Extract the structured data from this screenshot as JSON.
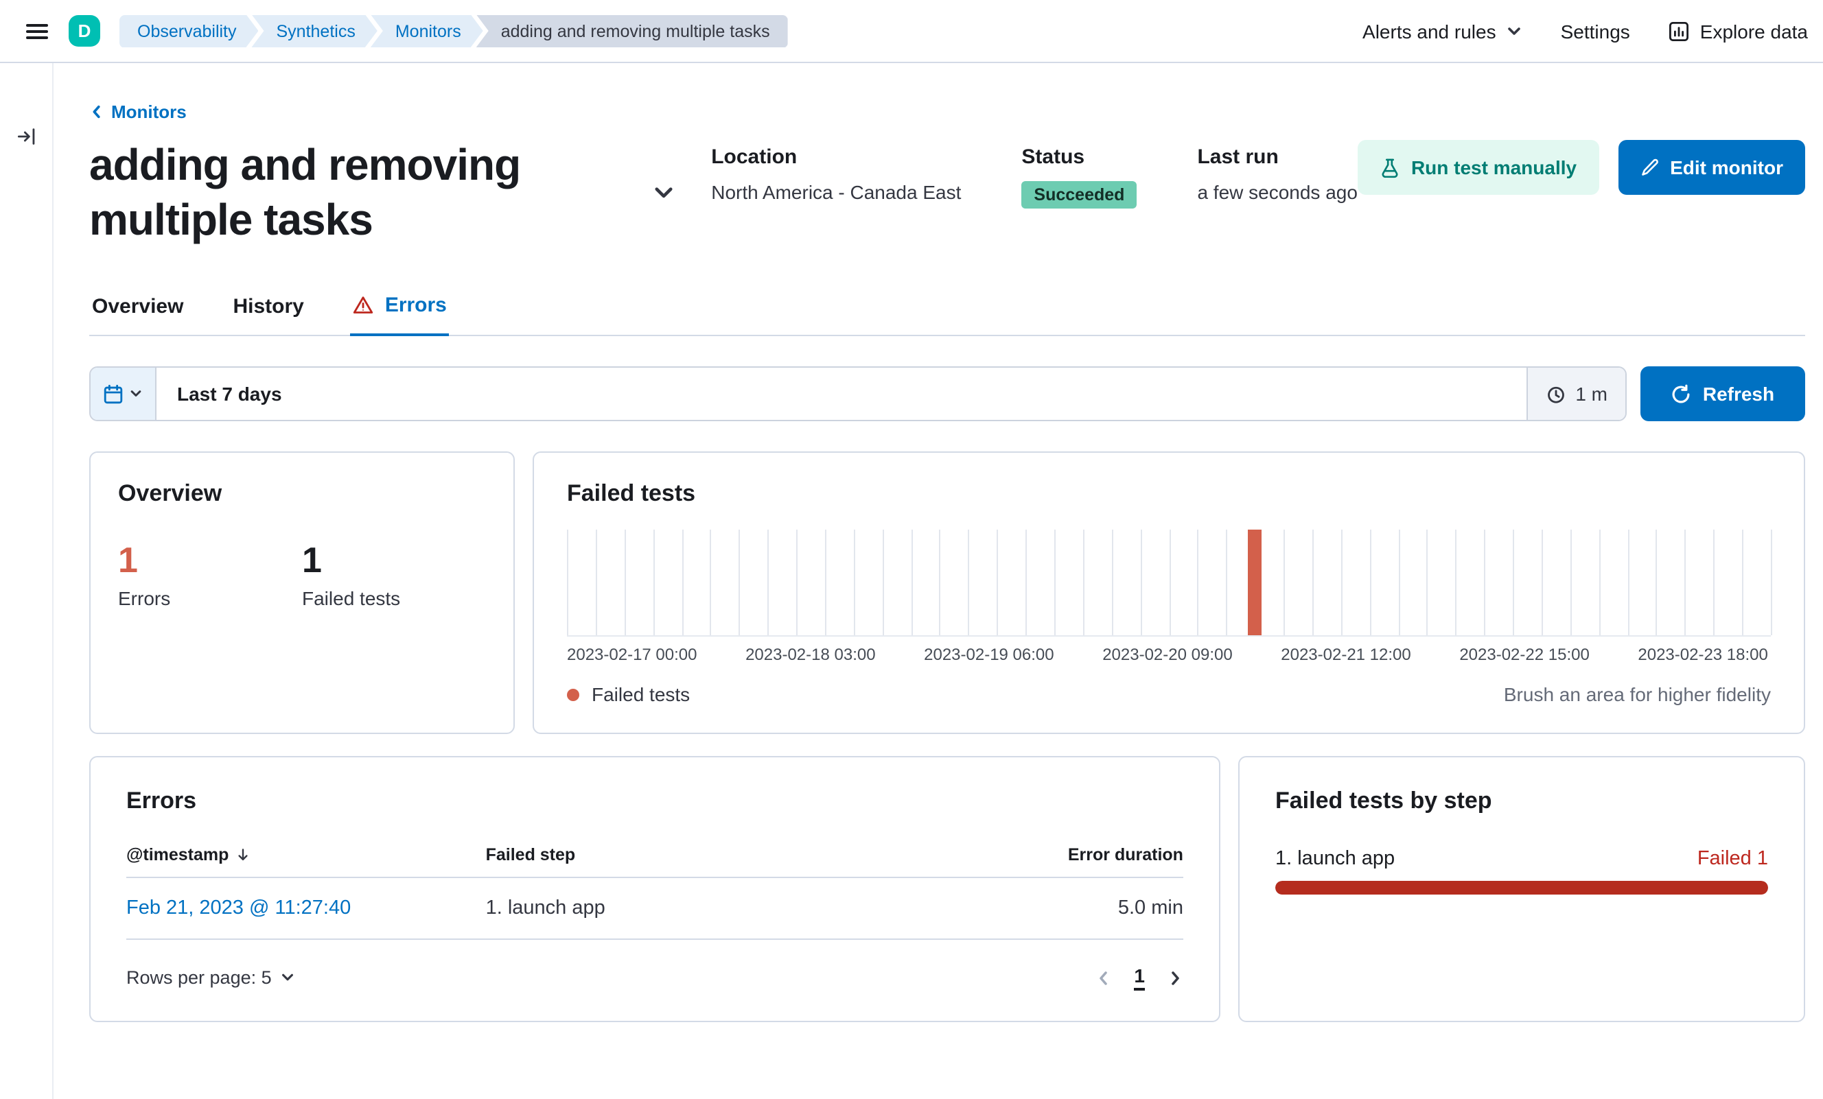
{
  "colors": {
    "primary_blue": "#0071c2",
    "logo_teal": "#00bfb3",
    "success_badge": "#6dccb1",
    "danger_red": "#bd271e",
    "chart_bar_red": "#d3604b"
  },
  "header": {
    "logo_letter": "D",
    "breadcrumbs": [
      {
        "label": "Observability"
      },
      {
        "label": "Synthetics"
      },
      {
        "label": "Monitors"
      },
      {
        "label": "adding and removing multiple tasks"
      }
    ],
    "alerts_menu": "Alerts and rules",
    "settings": "Settings",
    "explore_data": "Explore data"
  },
  "page": {
    "back_link": "Monitors",
    "title": "adding and removing multiple tasks",
    "meta": {
      "location_label": "Location",
      "location_value": "North America - Canada East",
      "status_label": "Status",
      "status_value": "Succeeded",
      "last_run_label": "Last run",
      "last_run_value": "a few seconds ago"
    },
    "actions": {
      "run_test": "Run test manually",
      "edit_monitor": "Edit monitor"
    },
    "tabs": [
      {
        "label": "Overview",
        "active": false
      },
      {
        "label": "History",
        "active": false
      },
      {
        "label": "Errors",
        "active": true
      }
    ]
  },
  "datepicker": {
    "range": "Last 7 days",
    "interval": "1 m",
    "refresh_label": "Refresh"
  },
  "overview_card": {
    "title": "Overview",
    "stats": [
      {
        "value": "1",
        "label": "Errors"
      },
      {
        "value": "1",
        "label": "Failed tests"
      }
    ]
  },
  "failed_tests_card": {
    "title": "Failed tests",
    "legend": "Failed tests",
    "hint": "Brush an area for higher fidelity"
  },
  "chart_data": {
    "type": "bar",
    "title": "Failed tests",
    "x_axis_labels": [
      "2023-02-17 00:00",
      "2023-02-18 03:00",
      "2023-02-19 06:00",
      "2023-02-20 09:00",
      "2023-02-21 12:00",
      "2023-02-22 15:00",
      "2023-02-23 18:00"
    ],
    "ylim": [
      0,
      1
    ],
    "gridline_count": 42,
    "series": [
      {
        "name": "Failed tests",
        "points": 1
      }
    ],
    "bars": [
      {
        "x": "2023-02-21 09:00",
        "y": 1,
        "position_pct": 57.1
      }
    ]
  },
  "errors_card": {
    "title": "Errors",
    "columns": [
      "@timestamp",
      "Failed step",
      "Error duration"
    ],
    "rows": [
      {
        "timestamp": "Feb 21, 2023 @ 11:27:40",
        "failed_step": "1. launch app",
        "duration": "5.0 min"
      }
    ],
    "rows_per_page": "Rows per page: 5",
    "page": "1"
  },
  "failed_steps_card": {
    "title": "Failed tests by step",
    "steps": [
      {
        "name": "1. launch app",
        "result": "Failed 1",
        "pct": 100
      }
    ]
  }
}
